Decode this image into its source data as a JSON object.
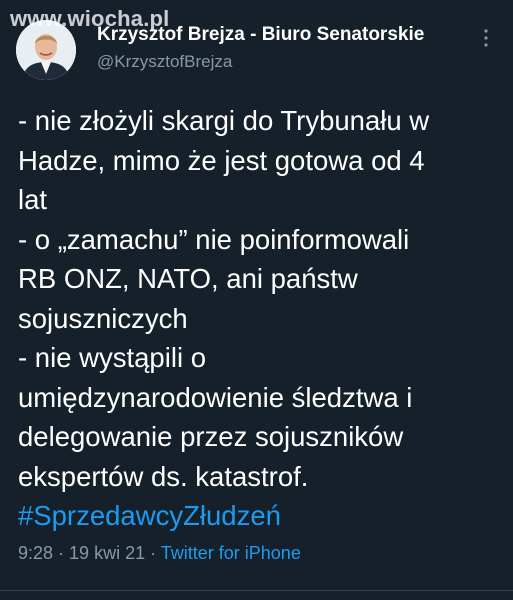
{
  "watermark": "www.wiocha.pl",
  "author": {
    "display_name": "Krzysztof Brejza - Biuro Senatorskie",
    "handle": "@KrzysztofBrejza",
    "avatar_icon": "person-avatar"
  },
  "more_icon": "more-vertical-icon",
  "tweet": {
    "lines": [
      "- nie złożyli skargi do Trybunału w",
      "Hadze, mimo że jest gotowa od 4",
      "lat",
      "- o „zamachu” nie poinformowali",
      "RB ONZ, NATO, ani państw",
      "sojuszniczych",
      "- nie wystąpili o",
      "umiędzynarodowienie śledztwa i",
      "delegowanie przez sojuszników",
      "ekspertów ds. katastrof."
    ],
    "hashtag": "#SprzedawcyZłudzeń"
  },
  "meta": {
    "time": "9:28",
    "sep1": " · ",
    "date": "19 kwi 21",
    "sep2": " · ",
    "source": "Twitter for iPhone"
  },
  "colors": {
    "background": "#15202b",
    "link": "#1d9bf0",
    "secondary_text": "#8899a6"
  }
}
